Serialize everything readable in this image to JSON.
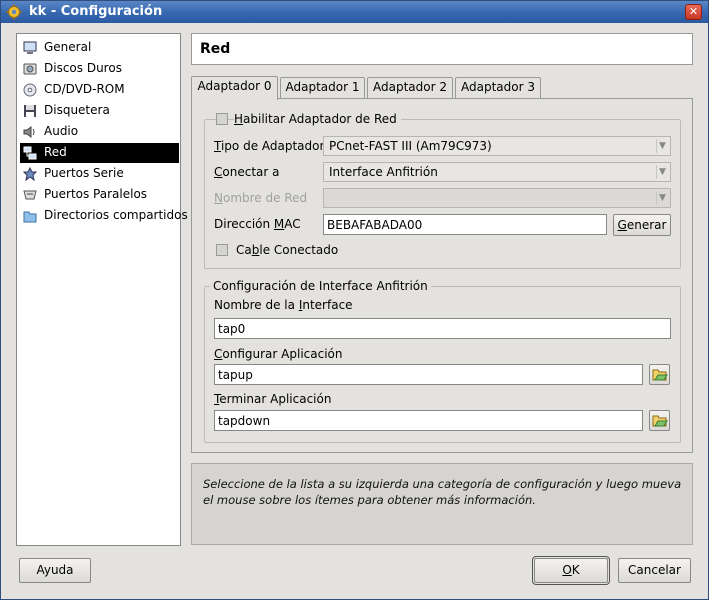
{
  "window": {
    "title": "kk - Configuración"
  },
  "sidebar": {
    "items": [
      {
        "label": "General",
        "icon": "monitor-icon"
      },
      {
        "label": "Discos Duros",
        "icon": "hard-disk-icon"
      },
      {
        "label": "CD/DVD-ROM",
        "icon": "cd-icon"
      },
      {
        "label": "Disquetera",
        "icon": "floppy-icon"
      },
      {
        "label": "Audio",
        "icon": "speaker-icon"
      },
      {
        "label": "Red",
        "icon": "network-icon",
        "selected": true
      },
      {
        "label": "Puertos Serie",
        "icon": "serial-port-icon"
      },
      {
        "label": "Puertos Paralelos",
        "icon": "parallel-port-icon"
      },
      {
        "label": "Directorios compartidos",
        "icon": "folder-icon"
      }
    ]
  },
  "header": {
    "title": "Red"
  },
  "tabs": [
    {
      "label": "Adaptador 0",
      "active": true
    },
    {
      "label": "Adaptador 1"
    },
    {
      "label": "Adaptador 2"
    },
    {
      "label": "Adaptador 3"
    }
  ],
  "adapter": {
    "enable_prefix": "H",
    "enable_rest": "abilitar Adaptador de Red",
    "type_prefix": "T",
    "type_rest": "ipo de Adaptador",
    "type_value": "PCnet-FAST III (Am79C973)",
    "connect_prefix": "C",
    "connect_rest": "onectar a",
    "connect_value": "Interface Anfitrión",
    "netname_prefix": "N",
    "netname_rest": "ombre de Red",
    "netname_value": "",
    "mac_label_a": "Dirección ",
    "mac_label_u": "M",
    "mac_label_b": "AC",
    "mac_value": "BEBAFABADA00",
    "generate_prefix": "G",
    "generate_rest": "enerar",
    "cable_a": "Ca",
    "cable_u": "b",
    "cable_b": "le Conectado"
  },
  "host_interface": {
    "legend": "Configuración de Interface Anfitrión",
    "name_label_a": "Nombre de la ",
    "name_label_u": "I",
    "name_label_b": "nterface",
    "name_value": "tap0",
    "setup_prefix": "C",
    "setup_rest": "onfigurar Aplicación",
    "setup_value": "tapup",
    "term_prefix": "T",
    "term_rest": "erminar Aplicación",
    "term_value": "tapdown"
  },
  "info": {
    "text": "Seleccione de la lista a su izquierda una categoría de configuración y luego mueva el mouse sobre los ítemes para obtener más información."
  },
  "buttons": {
    "help": "Ayuda",
    "ok_prefix": "O",
    "ok_rest": "K",
    "cancel": "Cancelar"
  }
}
